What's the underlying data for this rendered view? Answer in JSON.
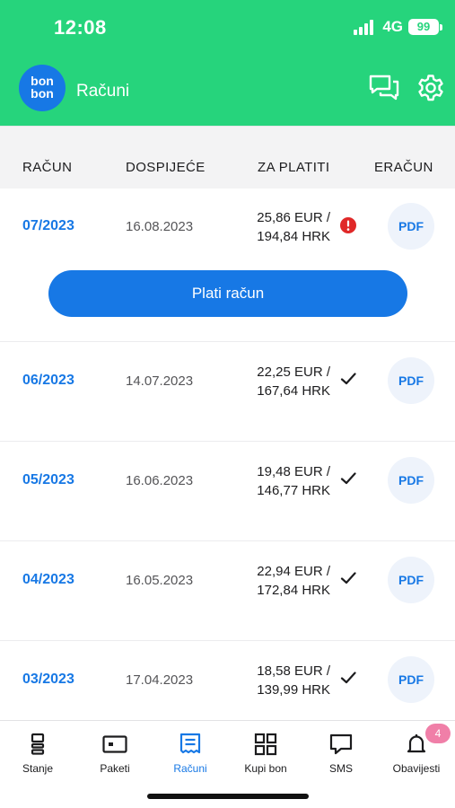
{
  "status_bar": {
    "time": "12:08",
    "network": "4G",
    "battery": "99"
  },
  "header": {
    "logo_text_1": "bon",
    "logo_text_2": "bon",
    "title": "Računi"
  },
  "table": {
    "columns": [
      "RAČUN",
      "DOSPIJEĆE",
      "ZA PLATITI",
      "ERAČUN"
    ],
    "rows": [
      {
        "period": "07/2023",
        "due": "16.08.2023",
        "amount_eur": "25,86 EUR /",
        "amount_hrk": "194,84 HRK",
        "status": "unpaid",
        "pdf": "PDF"
      },
      {
        "period": "06/2023",
        "due": "14.07.2023",
        "amount_eur": "22,25 EUR /",
        "amount_hrk": "167,64 HRK",
        "status": "paid",
        "pdf": "PDF"
      },
      {
        "period": "05/2023",
        "due": "16.06.2023",
        "amount_eur": "19,48 EUR /",
        "amount_hrk": "146,77 HRK",
        "status": "paid",
        "pdf": "PDF"
      },
      {
        "period": "04/2023",
        "due": "16.05.2023",
        "amount_eur": "22,94 EUR /",
        "amount_hrk": "172,84 HRK",
        "status": "paid",
        "pdf": "PDF"
      },
      {
        "period": "03/2023",
        "due": "17.04.2023",
        "amount_eur": "18,58 EUR /",
        "amount_hrk": "139,99 HRK",
        "status": "paid",
        "pdf": "PDF"
      }
    ],
    "pay_button": "Plati račun"
  },
  "nav": {
    "items": [
      {
        "label": "Stanje",
        "icon": "balance-icon"
      },
      {
        "label": "Paketi",
        "icon": "packages-icon"
      },
      {
        "label": "Računi",
        "icon": "bills-icon"
      },
      {
        "label": "Kupi bon",
        "icon": "grid-icon"
      },
      {
        "label": "SMS",
        "icon": "sms-icon"
      },
      {
        "label": "Obavijesti",
        "icon": "bell-icon"
      }
    ],
    "active_index": 2,
    "notification_count": "4"
  },
  "colors": {
    "brand_green": "#26d47c",
    "accent_blue": "#1778e5",
    "alert_red": "#e02828",
    "badge_pink": "#f07fa8"
  }
}
